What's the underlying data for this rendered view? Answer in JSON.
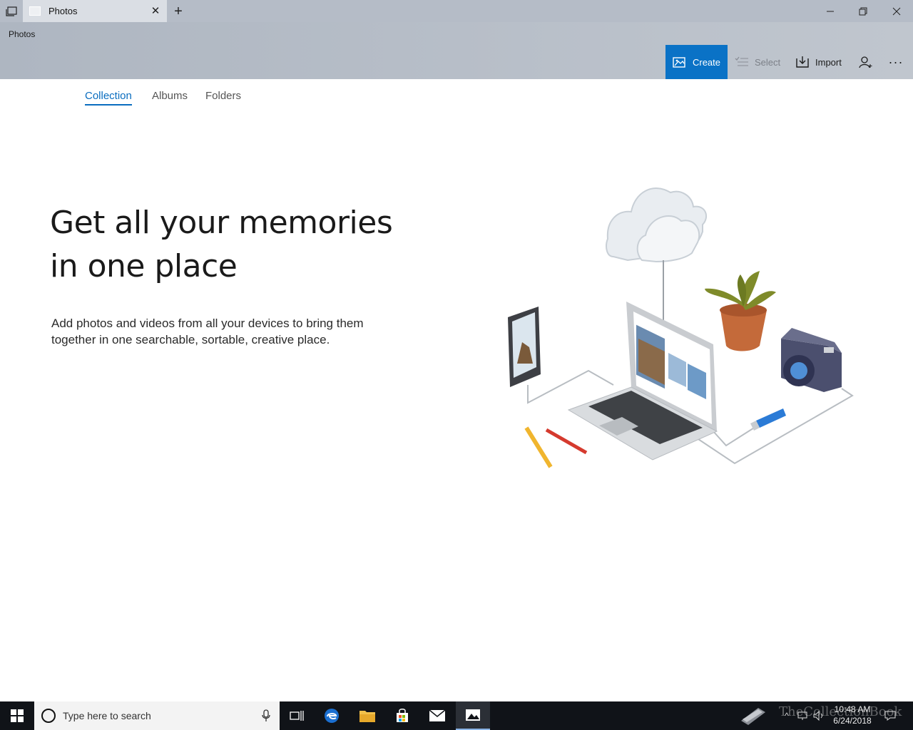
{
  "window": {
    "tab_title": "Photos",
    "tab_close_icon": "close-icon",
    "new_tab_icon": "plus-icon",
    "controls": [
      "minimize-icon",
      "restore-icon",
      "close-icon"
    ]
  },
  "app": {
    "title": "Photos"
  },
  "commands": {
    "create": "Create",
    "select": "Select",
    "import": "Import"
  },
  "pivot": {
    "tabs": [
      {
        "label": "Collection",
        "active": true
      },
      {
        "label": "Albums",
        "active": false
      },
      {
        "label": "Folders",
        "active": false
      }
    ]
  },
  "hero": {
    "title": "Get all your memories in one place",
    "description": "Add photos and videos from all your devices to bring them together in one searchable, sortable, creative place."
  },
  "taskbar": {
    "search_placeholder": "Type here to search",
    "time": "10:48 AM",
    "date": "6/24/2018",
    "watermark": "TheCollectionBook",
    "pinned": [
      "task-view-icon",
      "edge-icon",
      "file-explorer-icon",
      "store-icon",
      "mail-icon",
      "photos-icon"
    ]
  },
  "colors": {
    "accent": "#0a72c6",
    "header_bg": "#b7bec8",
    "taskbar_bg": "#101318"
  }
}
